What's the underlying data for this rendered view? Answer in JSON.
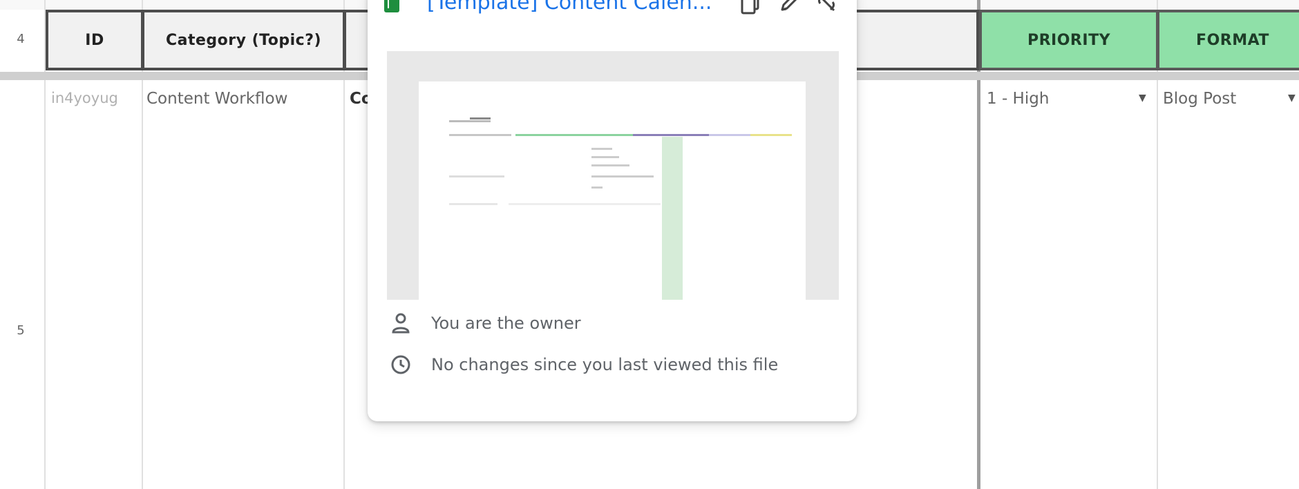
{
  "rows": [
    "4",
    "5"
  ],
  "headers": {
    "id": "ID",
    "category": "Category (Topic?)",
    "priority": "PRIORITY",
    "format": "FORMAT"
  },
  "row4": {
    "id": "in4yoyug",
    "category": "Content Workflow",
    "partial": "Co",
    "priority": "1 - High",
    "format": "Blog Post"
  },
  "popup": {
    "title": "[Template] Content Calen...",
    "owner_text": "You are the owner",
    "changes_text": "No changes since you last viewed this file",
    "icons": [
      "sheets-icon",
      "copy-icon",
      "edit-icon",
      "unlink-icon",
      "person-icon",
      "clock-icon"
    ]
  },
  "colors": {
    "header_green": "#8fe0a8",
    "link_blue": "#1a73e8",
    "sheets_green": "#1e8e3e"
  }
}
